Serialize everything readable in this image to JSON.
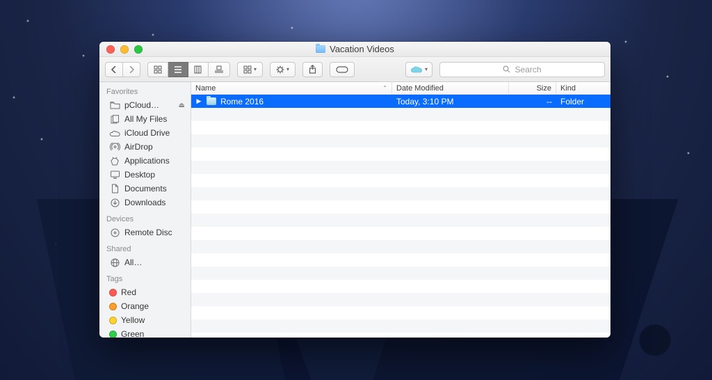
{
  "window": {
    "title": "Vacation Videos"
  },
  "toolbar": {
    "search_placeholder": "Search"
  },
  "columns": {
    "name": "Name",
    "date_modified": "Date Modified",
    "size": "Size",
    "kind": "Kind"
  },
  "rows": [
    {
      "name": "Rome 2016",
      "date_modified": "Today, 3:10 PM",
      "size": "--",
      "kind": "Folder",
      "selected": true
    }
  ],
  "sidebar": {
    "sections": {
      "favorites": {
        "label": "Favorites",
        "items": [
          {
            "label": "pCloud…",
            "icon": "folder",
            "eject": true
          },
          {
            "label": "All My Files",
            "icon": "all-my-files"
          },
          {
            "label": "iCloud Drive",
            "icon": "cloud"
          },
          {
            "label": "AirDrop",
            "icon": "airdrop"
          },
          {
            "label": "Applications",
            "icon": "applications"
          },
          {
            "label": "Desktop",
            "icon": "desktop"
          },
          {
            "label": "Documents",
            "icon": "documents"
          },
          {
            "label": "Downloads",
            "icon": "downloads"
          }
        ]
      },
      "devices": {
        "label": "Devices",
        "items": [
          {
            "label": "Remote Disc",
            "icon": "disc"
          }
        ]
      },
      "shared": {
        "label": "Shared",
        "items": [
          {
            "label": "All…",
            "icon": "network"
          }
        ]
      },
      "tags": {
        "label": "Tags",
        "items": [
          {
            "label": "Red",
            "color": "#ff5b53"
          },
          {
            "label": "Orange",
            "color": "#ff9e2c"
          },
          {
            "label": "Yellow",
            "color": "#ffd22e"
          },
          {
            "label": "Green",
            "color": "#30cf4c"
          }
        ]
      }
    }
  }
}
